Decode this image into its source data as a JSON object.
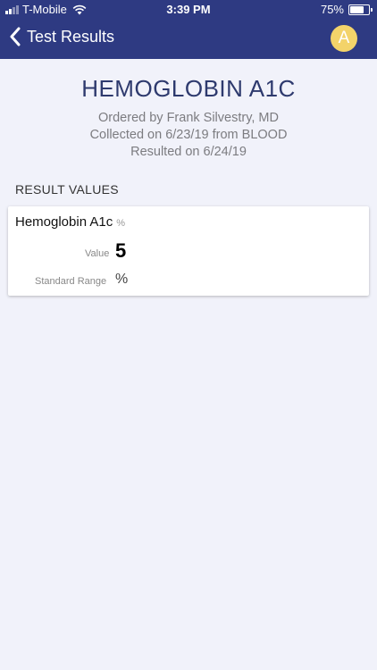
{
  "status_bar": {
    "carrier": "T-Mobile",
    "time": "3:39 PM",
    "battery": "75%",
    "battery_level": 0.75
  },
  "nav": {
    "back_label": "Test Results",
    "avatar_initial": "A"
  },
  "test": {
    "title": "HEMOGLOBIN A1C",
    "ordered_by": "Ordered by Frank Silvestry, MD",
    "collected": "Collected on 6/23/19 from BLOOD",
    "resulted": "Resulted on 6/24/19"
  },
  "result_values": {
    "section_label": "RESULT VALUES",
    "items": [
      {
        "name": "Hemoglobin A1c",
        "unit": "%",
        "value_label": "Value",
        "value": "5",
        "range_label": "Standard Range",
        "range": "%"
      }
    ]
  },
  "colors": {
    "nav_bg": "#2e3a82",
    "page_bg": "#f1f2fa",
    "avatar_bg": "#f3d36a",
    "title_color": "#2e3a6e"
  }
}
